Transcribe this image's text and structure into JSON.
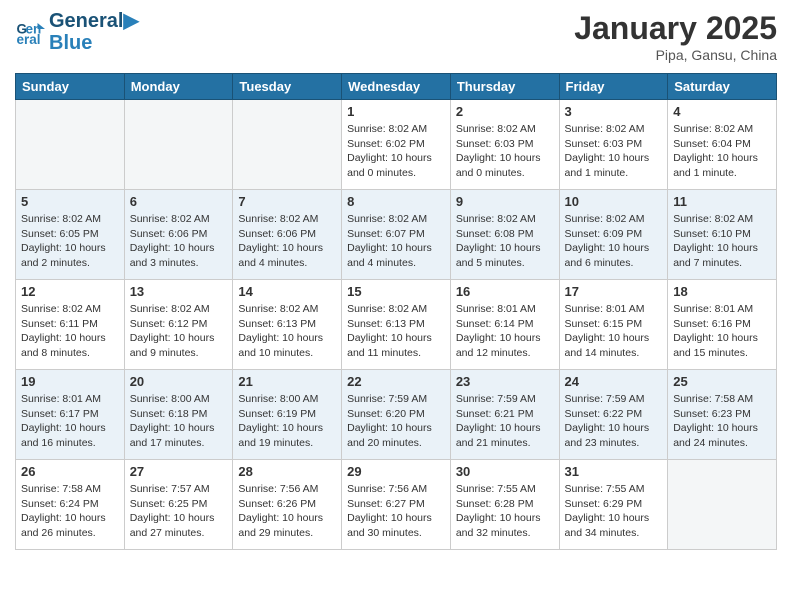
{
  "header": {
    "logo_line1": "General",
    "logo_line2": "Blue",
    "month": "January 2025",
    "location": "Pipa, Gansu, China"
  },
  "weekdays": [
    "Sunday",
    "Monday",
    "Tuesday",
    "Wednesday",
    "Thursday",
    "Friday",
    "Saturday"
  ],
  "weeks": [
    [
      {
        "day": "",
        "info": ""
      },
      {
        "day": "",
        "info": ""
      },
      {
        "day": "",
        "info": ""
      },
      {
        "day": "1",
        "info": "Sunrise: 8:02 AM\nSunset: 6:02 PM\nDaylight: 10 hours\nand 0 minutes."
      },
      {
        "day": "2",
        "info": "Sunrise: 8:02 AM\nSunset: 6:03 PM\nDaylight: 10 hours\nand 0 minutes."
      },
      {
        "day": "3",
        "info": "Sunrise: 8:02 AM\nSunset: 6:03 PM\nDaylight: 10 hours\nand 1 minute."
      },
      {
        "day": "4",
        "info": "Sunrise: 8:02 AM\nSunset: 6:04 PM\nDaylight: 10 hours\nand 1 minute."
      }
    ],
    [
      {
        "day": "5",
        "info": "Sunrise: 8:02 AM\nSunset: 6:05 PM\nDaylight: 10 hours\nand 2 minutes."
      },
      {
        "day": "6",
        "info": "Sunrise: 8:02 AM\nSunset: 6:06 PM\nDaylight: 10 hours\nand 3 minutes."
      },
      {
        "day": "7",
        "info": "Sunrise: 8:02 AM\nSunset: 6:06 PM\nDaylight: 10 hours\nand 4 minutes."
      },
      {
        "day": "8",
        "info": "Sunrise: 8:02 AM\nSunset: 6:07 PM\nDaylight: 10 hours\nand 4 minutes."
      },
      {
        "day": "9",
        "info": "Sunrise: 8:02 AM\nSunset: 6:08 PM\nDaylight: 10 hours\nand 5 minutes."
      },
      {
        "day": "10",
        "info": "Sunrise: 8:02 AM\nSunset: 6:09 PM\nDaylight: 10 hours\nand 6 minutes."
      },
      {
        "day": "11",
        "info": "Sunrise: 8:02 AM\nSunset: 6:10 PM\nDaylight: 10 hours\nand 7 minutes."
      }
    ],
    [
      {
        "day": "12",
        "info": "Sunrise: 8:02 AM\nSunset: 6:11 PM\nDaylight: 10 hours\nand 8 minutes."
      },
      {
        "day": "13",
        "info": "Sunrise: 8:02 AM\nSunset: 6:12 PM\nDaylight: 10 hours\nand 9 minutes."
      },
      {
        "day": "14",
        "info": "Sunrise: 8:02 AM\nSunset: 6:13 PM\nDaylight: 10 hours\nand 10 minutes."
      },
      {
        "day": "15",
        "info": "Sunrise: 8:02 AM\nSunset: 6:13 PM\nDaylight: 10 hours\nand 11 minutes."
      },
      {
        "day": "16",
        "info": "Sunrise: 8:01 AM\nSunset: 6:14 PM\nDaylight: 10 hours\nand 12 minutes."
      },
      {
        "day": "17",
        "info": "Sunrise: 8:01 AM\nSunset: 6:15 PM\nDaylight: 10 hours\nand 14 minutes."
      },
      {
        "day": "18",
        "info": "Sunrise: 8:01 AM\nSunset: 6:16 PM\nDaylight: 10 hours\nand 15 minutes."
      }
    ],
    [
      {
        "day": "19",
        "info": "Sunrise: 8:01 AM\nSunset: 6:17 PM\nDaylight: 10 hours\nand 16 minutes."
      },
      {
        "day": "20",
        "info": "Sunrise: 8:00 AM\nSunset: 6:18 PM\nDaylight: 10 hours\nand 17 minutes."
      },
      {
        "day": "21",
        "info": "Sunrise: 8:00 AM\nSunset: 6:19 PM\nDaylight: 10 hours\nand 19 minutes."
      },
      {
        "day": "22",
        "info": "Sunrise: 7:59 AM\nSunset: 6:20 PM\nDaylight: 10 hours\nand 20 minutes."
      },
      {
        "day": "23",
        "info": "Sunrise: 7:59 AM\nSunset: 6:21 PM\nDaylight: 10 hours\nand 21 minutes."
      },
      {
        "day": "24",
        "info": "Sunrise: 7:59 AM\nSunset: 6:22 PM\nDaylight: 10 hours\nand 23 minutes."
      },
      {
        "day": "25",
        "info": "Sunrise: 7:58 AM\nSunset: 6:23 PM\nDaylight: 10 hours\nand 24 minutes."
      }
    ],
    [
      {
        "day": "26",
        "info": "Sunrise: 7:58 AM\nSunset: 6:24 PM\nDaylight: 10 hours\nand 26 minutes."
      },
      {
        "day": "27",
        "info": "Sunrise: 7:57 AM\nSunset: 6:25 PM\nDaylight: 10 hours\nand 27 minutes."
      },
      {
        "day": "28",
        "info": "Sunrise: 7:56 AM\nSunset: 6:26 PM\nDaylight: 10 hours\nand 29 minutes."
      },
      {
        "day": "29",
        "info": "Sunrise: 7:56 AM\nSunset: 6:27 PM\nDaylight: 10 hours\nand 30 minutes."
      },
      {
        "day": "30",
        "info": "Sunrise: 7:55 AM\nSunset: 6:28 PM\nDaylight: 10 hours\nand 32 minutes."
      },
      {
        "day": "31",
        "info": "Sunrise: 7:55 AM\nSunset: 6:29 PM\nDaylight: 10 hours\nand 34 minutes."
      },
      {
        "day": "",
        "info": ""
      }
    ]
  ]
}
